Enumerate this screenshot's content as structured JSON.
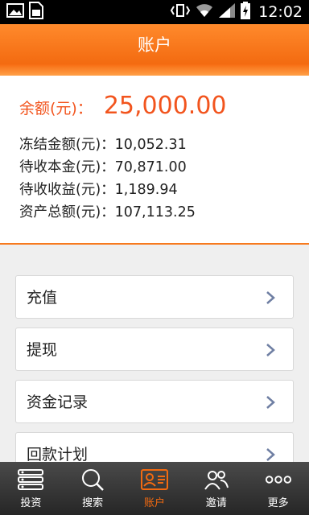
{
  "status_bar": {
    "time": "12:02",
    "icons": [
      "image-icon",
      "sim-icon",
      "vibrate-icon",
      "wifi-icon",
      "signal-icon",
      "battery-charging-icon"
    ]
  },
  "header": {
    "title": "账户"
  },
  "account": {
    "balance_label": "余额(元)：",
    "balance_value": "25,000.00",
    "details": [
      {
        "label": "冻结金额(元)：",
        "value": "10,052.31"
      },
      {
        "label": "待收本金(元)：",
        "value": "70,871.00"
      },
      {
        "label": "待收收益(元)：",
        "value": "1,189.94"
      },
      {
        "label": "资产总额(元)：",
        "value": "107,113.25"
      }
    ]
  },
  "menu": {
    "items": [
      {
        "label": "充值",
        "icon": "chevron-right-icon"
      },
      {
        "label": "提现",
        "icon": "chevron-right-icon"
      },
      {
        "label": "资金记录",
        "icon": "chevron-right-icon"
      },
      {
        "label": "回款计划",
        "icon": "chevron-right-icon"
      }
    ]
  },
  "bottom_nav": {
    "items": [
      {
        "label": "投资",
        "icon": "list-icon"
      },
      {
        "label": "搜索",
        "icon": "search-icon"
      },
      {
        "label": "账户",
        "icon": "account-card-icon"
      },
      {
        "label": "邀请",
        "icon": "invite-users-icon"
      },
      {
        "label": "更多",
        "icon": "more-dots-icon"
      }
    ],
    "active": "账户"
  },
  "colors": {
    "accent": "#f36a10",
    "balance": "#f2541d",
    "nav_bg": "#333333"
  }
}
